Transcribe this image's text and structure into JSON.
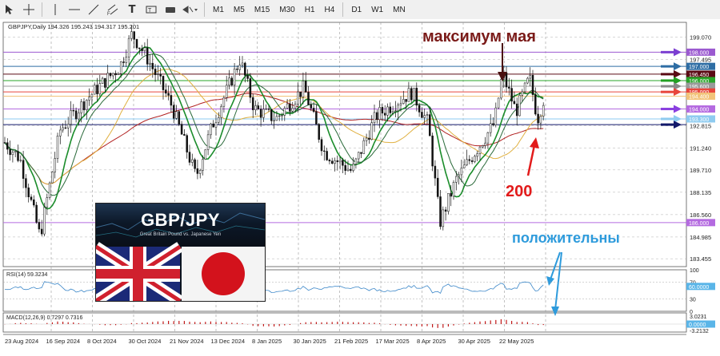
{
  "toolbar": {
    "tools": [
      "cursor-icon",
      "crosshair-icon",
      "vertical-line-icon",
      "horizontal-line-icon",
      "trendline-icon",
      "channel-icon",
      "text-icon",
      "label-icon",
      "shapes-icon",
      "arrow-icon"
    ],
    "timeframes": [
      "M1",
      "M5",
      "M15",
      "M30",
      "H1",
      "H4",
      "D1",
      "W1",
      "MN"
    ]
  },
  "chart": {
    "header": "GBPJPY,Daily  194.326 195.243 194.317 195.201",
    "annotations": {
      "max_may": "максимум мая",
      "ma200": "200",
      "positive": "положительны"
    },
    "price_ticks": [
      "199.070",
      "197.495",
      "195.920",
      "194.345",
      "192.815",
      "191.240",
      "189.710",
      "188.135",
      "186.560",
      "184.985",
      "183.455"
    ],
    "price_ticks_display": [
      {
        "label": "199.070",
        "price": 199.07
      },
      {
        "label": "197.495",
        "price": 197.495
      },
      {
        "label": "192.815",
        "price": 192.815
      },
      {
        "label": "191.240",
        "price": 191.24
      },
      {
        "label": "189.710",
        "price": 189.71
      },
      {
        "label": "188.135",
        "price": 188.135
      },
      {
        "label": "186.560",
        "price": 186.56
      },
      {
        "label": "184.985",
        "price": 184.985
      },
      {
        "label": "183.455",
        "price": 183.455
      }
    ],
    "levels": [
      {
        "price": 198.0,
        "label": "198.000",
        "color": "#9b59d0",
        "arrow": "#7b3fd1"
      },
      {
        "price": 197.0,
        "label": "197.000",
        "color": "#2e6da4",
        "arrow": "#2e6da4"
      },
      {
        "price": 196.45,
        "label": "196.450",
        "color": "#5a0a14",
        "arrow": "#5a0a14"
      },
      {
        "price": 196.0,
        "label": "196.000",
        "color": "#2aa52a",
        "arrow": "#22a022"
      },
      {
        "price": 195.6,
        "label": "195.600",
        "color": "#9a9a9a",
        "arrow": "#8a8a8a"
      },
      {
        "price": 195.2,
        "label": "195.000",
        "color": "#e8463c",
        "arrow": "#e8463c"
      },
      {
        "price": 194.9,
        "label": "194.400",
        "color": "#f2c37a",
        "arrow": ""
      },
      {
        "price": 194.0,
        "label": "194.000",
        "color": "#b46ae0",
        "arrow": "#8a3fe0"
      },
      {
        "price": 193.3,
        "label": "193.300",
        "color": "#8ecbf0",
        "arrow": "#8ecbf0"
      },
      {
        "price": 192.9,
        "label": "",
        "color": "#13196b",
        "arrow": "#13196b"
      },
      {
        "price": 186.0,
        "label": "186.000",
        "color": "#b46ae0",
        "arrow": ""
      }
    ],
    "dates": [
      "23 Aug 2024",
      "16 Sep 2024",
      "8 Oct 2024",
      "30 Oct 2024",
      "21 Nov 2024",
      "13 Dec 2024",
      "8 Jan 2025",
      "30 Jan 2025",
      "21 Feb 2025",
      "17 Mar 2025",
      "8 Apr 2025",
      "30 Apr 2025",
      "22 May 2025"
    ],
    "ylim": [
      182.9,
      200.1
    ],
    "rsi": {
      "label": "RSI(14) 59.3234",
      "ticks": [
        "100",
        "70",
        "30",
        "0"
      ],
      "current": "60.0000"
    },
    "macd": {
      "label": "MACD(12,26,9) 0.7297 0.7316",
      "ticks": [
        "3.0231",
        "0.00",
        "-3.2132"
      ],
      "current": "0.0000"
    }
  },
  "inset": {
    "title": "GBP/JPY",
    "subtitle": "Great Britain Pound vs. Japanese Yen"
  },
  "chart_data": {
    "type": "candlestick",
    "title": "GBPJPY,Daily",
    "x": [
      "23 Aug 2024",
      "16 Sep 2024",
      "8 Oct 2024",
      "30 Oct 2024",
      "21 Nov 2024",
      "13 Dec 2024",
      "8 Jan 2025",
      "30 Jan 2025",
      "21 Feb 2025",
      "17 Mar 2025",
      "8 Apr 2025",
      "30 Apr 2025",
      "22 May 2025"
    ],
    "series": [
      {
        "values": [
          192.0,
          187.0,
          194.5,
          196.0,
          191.0,
          193.5,
          196.5,
          191.0,
          190.0,
          193.8,
          188.0,
          191.5,
          194.5
        ]
      }
    ],
    "ylim": [
      182.9,
      200.1
    ]
  }
}
